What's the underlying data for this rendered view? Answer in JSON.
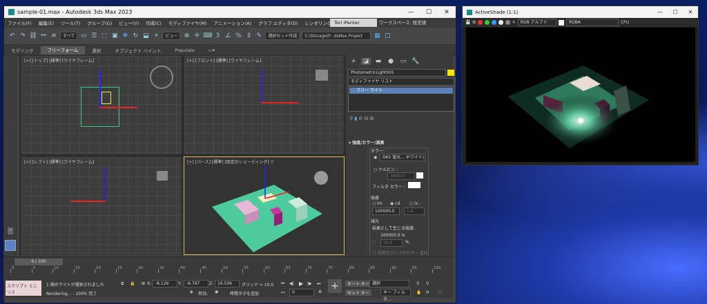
{
  "main_window": {
    "title": "sample-01.max - Autodesk 3ds Max 2023",
    "controls": [
      "—",
      "☐",
      "✕"
    ],
    "menu": [
      "ファイル(F)",
      "編集(E)",
      "ツール(T)",
      "グループ(G)",
      "ビュー(V)",
      "作成(C)",
      "モディファイヤ(M)",
      "アニメーション(A)",
      "グラフ エディタ(D)",
      "レンダリング(R)"
    ],
    "user": "Tori iPentec",
    "workspace_label": "ワークスペース:",
    "workspace_value": "既定値",
    "selection_filter": "すべて",
    "view_dropdown": "ビュー",
    "named_selection": "選択セット作成",
    "project_path": "C:\\Storage\\P...dsMax Project",
    "ribbon_tabs": [
      "モデリング",
      "フリーフォーム",
      "選択",
      "オブジェクト ペイント",
      "Populate"
    ]
  },
  "viewports": {
    "top": "[+] [トップ] [標準] [ワイヤフレーム]",
    "front": "[+] [フロント] [標準] [ワイヤフレーム]",
    "left": "[+] [レフト] [標準] [ワイヤフレーム]",
    "persp": "[+] [パース] [標準] [既定のシェーディング]",
    "persp_filter": "▽"
  },
  "command_panel": {
    "object_name": "PhotometricLight001",
    "modifier_list": "モディファイヤ リスト",
    "stack_item": "フリー ライト",
    "section_title": "強度/カラー/減衰",
    "color_label": "カラー:",
    "color_preset": "D65 蛍光... ホワイト)",
    "kelvin_label": "ケルビン :",
    "kelvin_value": "3600.0",
    "filter_color_label": "フィルタ カラー :",
    "intensity_label": "強度",
    "units": [
      "lm",
      "cd",
      "lx :"
    ],
    "intensity_value": "100000.0",
    "lx_distance": "1.0",
    "dimming_label": "減光",
    "resulting_intensity_label": "結果として生じる強度:",
    "resulting_intensity_value": "100000.0 lx",
    "dim_percent_value": "50.0",
    "dim_percent_unit": "%",
    "incandescent_label": "白熱光ランプのカラー 変化"
  },
  "timeline": {
    "slider_label": "0 / 100",
    "ticks": [
      "0",
      "5",
      "10",
      "15",
      "20",
      "25",
      "30",
      "35",
      "40",
      "45",
      "50",
      "55",
      "60",
      "65",
      "70",
      "75",
      "80",
      "85",
      "90",
      "95",
      "100"
    ]
  },
  "status_bar": {
    "script_label": "スクリプト ミニ リス",
    "message": "1 個のライトが選択されました",
    "rendering": "Rendering... : 100% 完了",
    "x_label": "X:",
    "x_value": "-8.126",
    "y_label": "Y:",
    "y_value": "-6.767",
    "z_label": "Z:",
    "z_value": "16.506",
    "grid_label": "グリッド = 10.0",
    "enabled_label": "有効:",
    "add_time_tag": "時間タグを追加",
    "frame_value": "0",
    "auto_key": "オート キー",
    "set_key": "セット キー",
    "selection_dd": "選択",
    "key_filter": "キー フィルタ..."
  },
  "activeshade": {
    "title": "ActiveShade (1:1)",
    "channel": "RGB アルファ",
    "format": "RGBA",
    "device": "CPU",
    "controls": [
      "—",
      "☐",
      "✕"
    ]
  }
}
